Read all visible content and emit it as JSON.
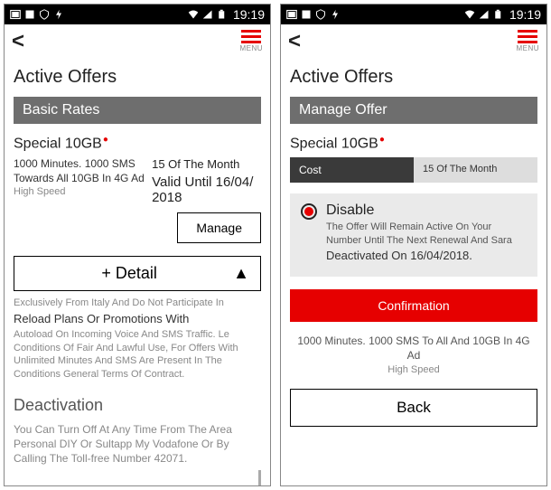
{
  "statusbar": {
    "time": "19:19"
  },
  "appbar": {
    "menu_label": "MENU"
  },
  "left": {
    "page_title": "Active Offers",
    "section_header": "Basic Rates",
    "offer_name": "Special 10GB",
    "minutes_sms": "1000 Minutes. 1000 SMS",
    "towards": "Towards All 10GB In 4G Ad",
    "high_speed": "High Speed",
    "period": "15 Of The Month",
    "valid_until": "Valid Until 16/04/ 2018",
    "manage_btn": "Manage",
    "detail_label": "+ Detail",
    "fine1": "Exclusively From Italy And Do Not Participate In",
    "fine_bold": "Reload Plans Or Promotions With",
    "fine2": "Autoload On Incoming Voice And SMS Traffic. Le Conditions Of Fair And Lawful Use, For Offers With Unlimited Minutes And SMS Are Present In The Conditions General Terms Of Contract.",
    "deact_title": "Deactivation",
    "deact_text": "You Can Turn Off At Any Time From The Area Personal DIY Or Sultapp My Vodafone Or By Calling The Toll-free Number 42071."
  },
  "right": {
    "page_title": "Active Offers",
    "section_header": "Manage Offer",
    "offer_name": "Special 10GB",
    "tab_cost": "Cost",
    "tab_period": "15 Of The Month",
    "disable_title": "Disable",
    "disable_sub": "The Offer Will Remain Active On Your Number Until The Next Renewal And Sara",
    "disable_date": "Deactivated On 16/04/2018.",
    "confirm_btn": "Confirmation",
    "summary": "1000 Minutes.  1000 SMS To All And 10GB In 4G Ad",
    "summary_hs": "High Speed",
    "back_btn": "Back"
  }
}
